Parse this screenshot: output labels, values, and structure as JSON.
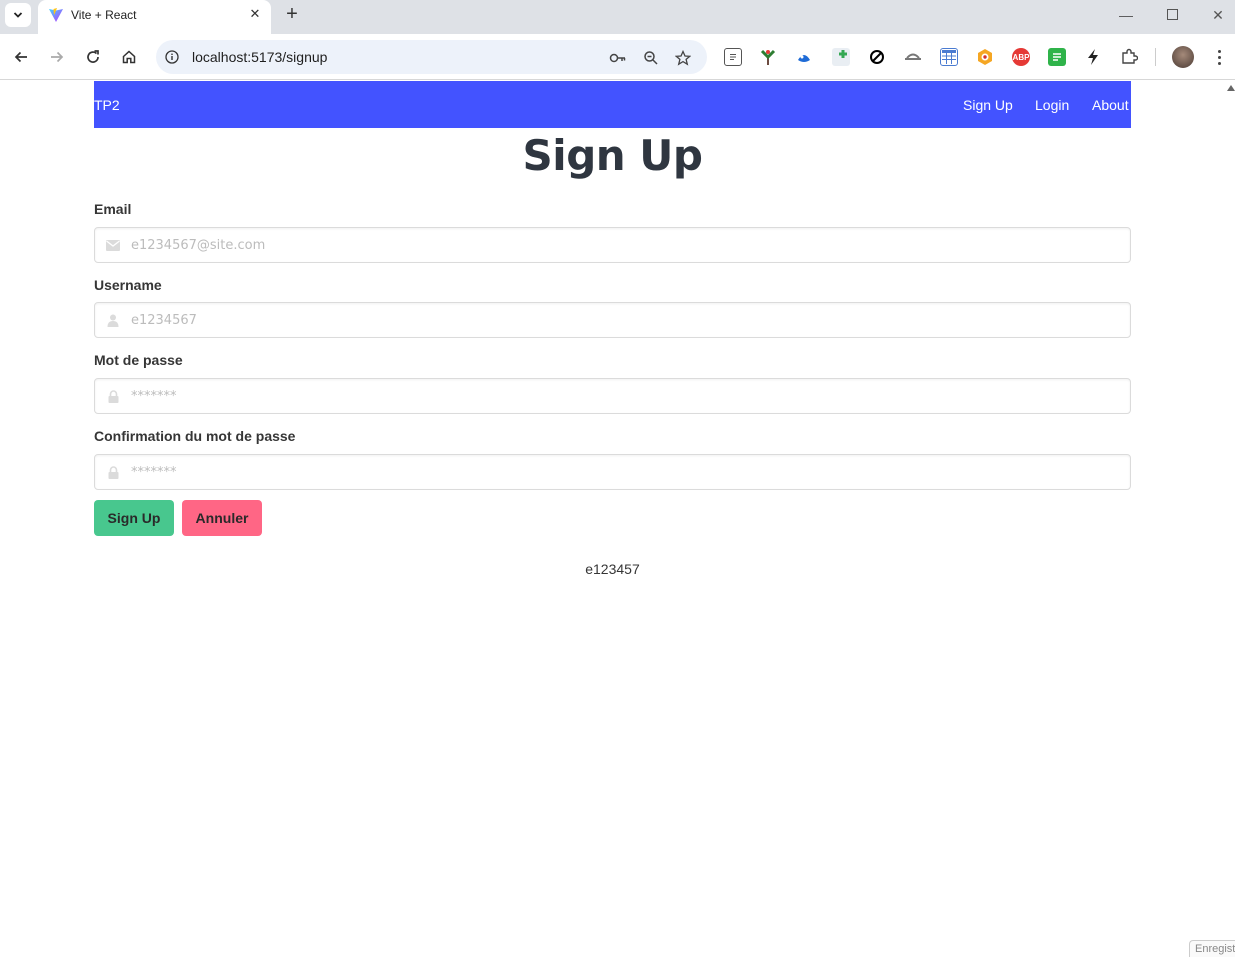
{
  "browser": {
    "tab_title": "Vite + React",
    "url": "localhost:5173/signup",
    "window_controls": [
      "minimize-icon",
      "maximize-icon",
      "close-icon"
    ],
    "extensions": [
      {
        "name": "reader-mode-icon",
        "color": "#ffffff"
      },
      {
        "name": "tree-extension-icon",
        "color": "#2e7d32"
      },
      {
        "name": "blue-extension-icon",
        "color": "#1e6bd6"
      },
      {
        "name": "green-plus-extension-icon",
        "color": "#34a853"
      },
      {
        "name": "block-extension-icon",
        "color": "#000000"
      },
      {
        "name": "hat-extension-icon",
        "color": "#888888"
      },
      {
        "name": "calendar-extension-icon",
        "color": "#4a7bd1"
      },
      {
        "name": "orange-extension-icon",
        "color": "#f5a623"
      },
      {
        "name": "adblock-plus-icon",
        "color": "#e53935",
        "text": "ABP"
      },
      {
        "name": "green-doc-extension-icon",
        "color": "#2fb34a"
      },
      {
        "name": "bolt-extension-icon",
        "color": "#222222"
      },
      {
        "name": "extensions-puzzle-icon",
        "color": "#444444"
      }
    ]
  },
  "navbar": {
    "brand": "TP2",
    "links": [
      "Sign Up",
      "Login",
      "About"
    ],
    "color": "#4353ff"
  },
  "form": {
    "title": "Sign Up",
    "fields": [
      {
        "label": "Email",
        "placeholder": "e1234567@site.com",
        "icon": "envelope-icon"
      },
      {
        "label": "Username",
        "placeholder": "e1234567",
        "icon": "user-icon"
      },
      {
        "label": "Mot de passe",
        "placeholder": "*******",
        "icon": "lock-icon"
      },
      {
        "label": "Confirmation du mot de passe",
        "placeholder": "*******",
        "icon": "lock-icon"
      }
    ],
    "submit_label": "Sign Up",
    "cancel_label": "Annuler",
    "submit_color": "#48c78e",
    "cancel_color": "#ff6685"
  },
  "footer": {
    "text": "e123457"
  },
  "corner_badge": "Enregist"
}
